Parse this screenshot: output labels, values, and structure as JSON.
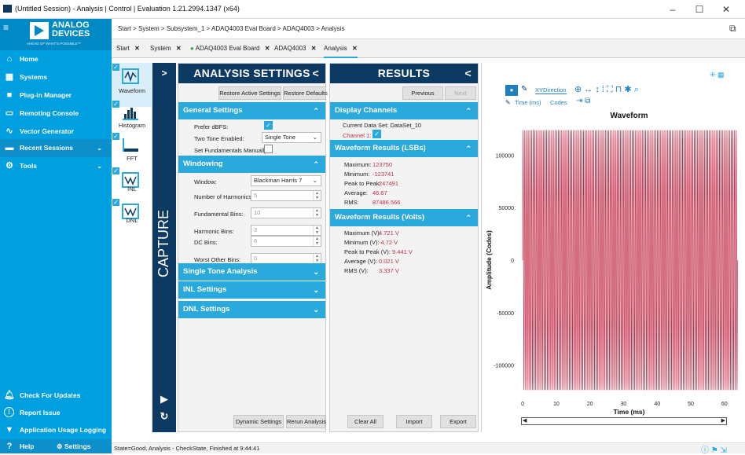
{
  "window": {
    "title": "(Untitled Session) - Analysis | Control | Evaluation 1.21.2994.1347 (x64)",
    "minimize": "–",
    "maximize": "☐",
    "close": "✕"
  },
  "logo": {
    "line1": "ANALOG",
    "line2": "DEVICES",
    "tagline": "AHEAD OF WHAT'S POSSIBLE™"
  },
  "nav": {
    "home": "Home",
    "systems": "Systems",
    "plugin_manager": "Plug-in Manager",
    "remoting_console": "Remoting Console",
    "vector_generator": "Vector Generator",
    "recent_sessions": "Recent Sessions",
    "tools": "Tools",
    "check_updates": "Check For Updates",
    "report_issue": "Report Issue",
    "usage_logging": "Application Usage Logging",
    "help": "Help",
    "settings": "Settings"
  },
  "breadcrumb": [
    "Start",
    "System",
    "Subsystem_1",
    "ADAQ4003 Eval Board",
    "ADAQ4003",
    "Analysis"
  ],
  "breadcrumb_sep": ">",
  "tabs": [
    "Start",
    "System",
    "ADAQ4003 Eval Board",
    "ADAQ4003",
    "Analysis"
  ],
  "plugins": [
    "Waveform",
    "Histogram",
    "FFT",
    "INL",
    "DNL"
  ],
  "capture": {
    "label": "CAPTURE",
    "expand": ">",
    "play": "▶",
    "refresh": "↻"
  },
  "analysis": {
    "title": "ANALYSIS SETTINGS",
    "collapse": "<",
    "restore_active": "Restore Active Settings",
    "restore_defaults": "Restore Defaults",
    "general": {
      "header": "General Settings",
      "prefer_dbfs": "Prefer dBFS:",
      "two_tone": "Two Tone Enabled:",
      "two_tone_value": "Single Tone",
      "set_fund": "Set Fundamentals Manually:"
    },
    "windowing": {
      "header": "Windowing",
      "window": "Window:",
      "window_value": "Blackman Harris 7",
      "harmonics": "Number of Harmonics:",
      "harmonics_value": "5",
      "fund_bins": "Fundamental Bins:",
      "fund_bins_value": "10",
      "harm_bins": "Harmonic Bins:",
      "harm_bins_value": "3",
      "dc_bins": "DC Bins:",
      "dc_bins_value": "6",
      "worst_bins": "Worst Other Bins:",
      "worst_bins_value": "0"
    },
    "single_tone": "Single Tone Analysis",
    "inl": "INL Settings",
    "dnl": "DNL Settings",
    "dynamic": "Dynamic Settings",
    "rerun": "Rerun Analysis"
  },
  "results": {
    "title": "RESULTS",
    "collapse": "<",
    "previous": "Previous",
    "next": "Next",
    "display_channels": "Display Channels",
    "dataset": "Current Data Set: DataSet_10",
    "channel": "Channel 1:",
    "lsb_header": "Waveform Results (LSBs)",
    "lsb": [
      {
        "k": "Maximum:",
        "v": "123750"
      },
      {
        "k": "Minimum:",
        "v": "-123741"
      },
      {
        "k": "Peak to Peak:",
        "v": "247491"
      },
      {
        "k": "Average:",
        "v": "46.67"
      },
      {
        "k": "RMS:",
        "v": "87486.566"
      }
    ],
    "volt_header": "Waveform Results (Volts)",
    "volts": [
      {
        "k": "Maximum (V):",
        "v": "4.721 V"
      },
      {
        "k": "Minimum (V):",
        "v": "-4.72 V"
      },
      {
        "k": "Peak to Peak (V):",
        "v": "9.441 V"
      },
      {
        "k": "Average (V):",
        "v": "0.021 V"
      },
      {
        "k": "RMS (V):",
        "v": "3.337 V"
      }
    ],
    "clear_all": "Clear All",
    "import": "Import",
    "export": "Export"
  },
  "toolbar": {
    "xydirection": "XYDirection",
    "time": "Time (ms)",
    "codes": "Codes"
  },
  "chart_data": {
    "type": "line",
    "title": "Waveform",
    "xlabel": "Time (ms)",
    "ylabel": "Amplitude (Codes)",
    "xlim": [
      -1.2,
      64.5
    ],
    "ylim": [
      -125000,
      125000
    ],
    "xticks": [
      0,
      10,
      20,
      30,
      40,
      50,
      60
    ],
    "yticks": [
      -100000,
      -50000,
      0,
      50000,
      100000
    ],
    "ytick_labels": [
      "-100000",
      "-50000",
      "0",
      "50000",
      "100000"
    ],
    "series": [
      {
        "color": "#c0304b",
        "amplitude": 123750,
        "cycles": 128,
        "x_start": 0,
        "x_end": 63.9
      }
    ],
    "grid": false
  },
  "status": {
    "text": "State=Good, Analysis - CheckState, Finished at 9:44:41"
  },
  "colors": {
    "sidebar": "#009fdf",
    "navy": "#0d3a63",
    "accent": "#2aa9dc",
    "series": "#c0304b"
  }
}
